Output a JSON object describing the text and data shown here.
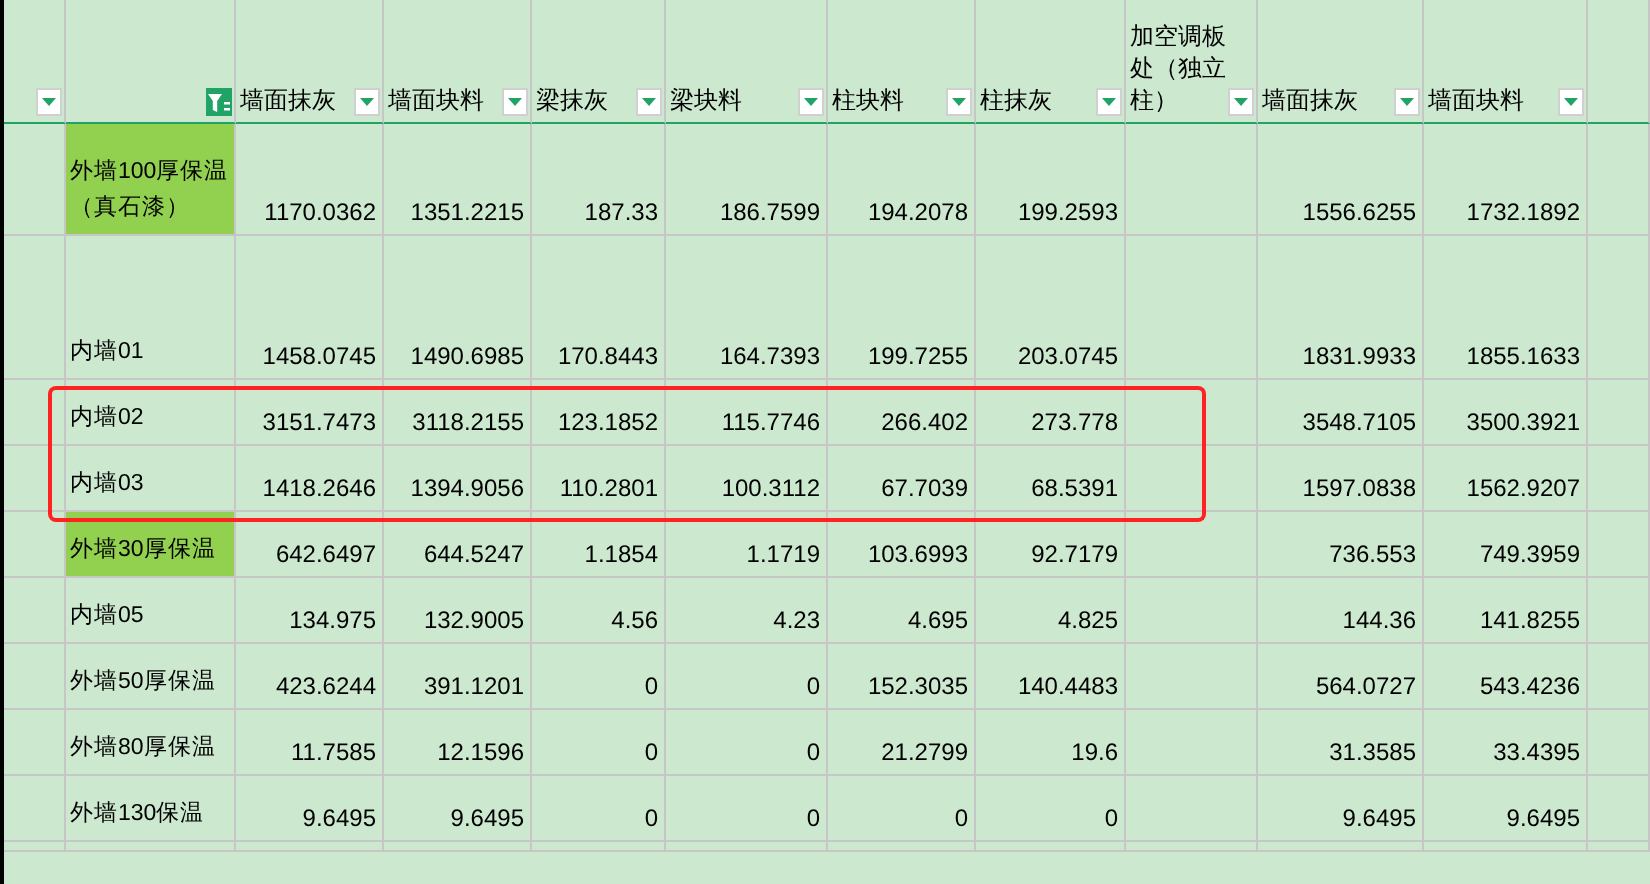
{
  "columns": [
    {
      "filtered": false
    },
    {
      "filtered": true
    },
    {
      "label": "墙面抹灰",
      "filtered": false,
      "cells": [
        "1170.0362",
        "1458.0745",
        "3151.7473",
        "1418.2646",
        "642.6497",
        "134.975",
        "423.6244",
        "11.7585",
        "9.6495"
      ]
    },
    {
      "label": "墙面块料",
      "filtered": false,
      "cells": [
        "1351.2215",
        "1490.6985",
        "3118.2155",
        "1394.9056",
        "644.5247",
        "132.9005",
        "391.1201",
        "12.1596",
        "9.6495"
      ]
    },
    {
      "label": "梁抹灰",
      "filtered": false,
      "cells": [
        "187.33",
        "170.8443",
        "123.1852",
        "110.2801",
        "1.1854",
        "4.56",
        "0",
        "0",
        "0"
      ]
    },
    {
      "label": "梁块料",
      "filtered": false,
      "cells": [
        "186.7599",
        "164.7393",
        "115.7746",
        "100.3112",
        "1.1719",
        "4.23",
        "0",
        "0",
        "0"
      ]
    },
    {
      "label": "柱块料",
      "filtered": false,
      "cells": [
        "194.2078",
        "199.7255",
        "266.402",
        "67.7039",
        "103.6993",
        "4.695",
        "152.3035",
        "21.2799",
        "0"
      ]
    },
    {
      "label": "柱抹灰",
      "filtered": false,
      "cells": [
        "199.2593",
        "203.0745",
        "273.778",
        "68.5391",
        "92.7179",
        "4.825",
        "140.4483",
        "19.6",
        "0"
      ]
    },
    {
      "label": "加空调板处（独立柱）",
      "filtered": false
    },
    {
      "label": "墙面抹灰",
      "filtered": false,
      "cells": [
        "1556.6255",
        "1831.9933",
        "3548.7105",
        "1597.0838",
        "736.553",
        "144.36",
        "564.0727",
        "31.3585",
        "9.6495"
      ]
    },
    {
      "label": "墙面块料",
      "filtered": false,
      "cells": [
        "1732.1892",
        "1855.1633",
        "3500.3921",
        "1562.9207",
        "749.3959",
        "141.8255",
        "543.4236",
        "33.4395",
        "9.6495"
      ]
    }
  ],
  "rows": [
    {
      "name": "外墙100厚保温（真石漆）",
      "highlighted": true,
      "boxed": false
    },
    {
      "name": "内墙01",
      "highlighted": false,
      "boxed": false
    },
    {
      "name": "内墙02",
      "highlighted": false,
      "boxed": true
    },
    {
      "name": "内墙03",
      "highlighted": false,
      "boxed": true
    },
    {
      "name": "外墙30厚保温",
      "highlighted": true,
      "boxed": false
    },
    {
      "name": "内墙05",
      "highlighted": false,
      "boxed": false
    },
    {
      "name": "外墙50厚保温",
      "highlighted": false,
      "boxed": false
    },
    {
      "name": "外墙80厚保温",
      "highlighted": false,
      "boxed": false
    },
    {
      "name": "外墙130保温",
      "highlighted": false,
      "boxed": false
    }
  ]
}
